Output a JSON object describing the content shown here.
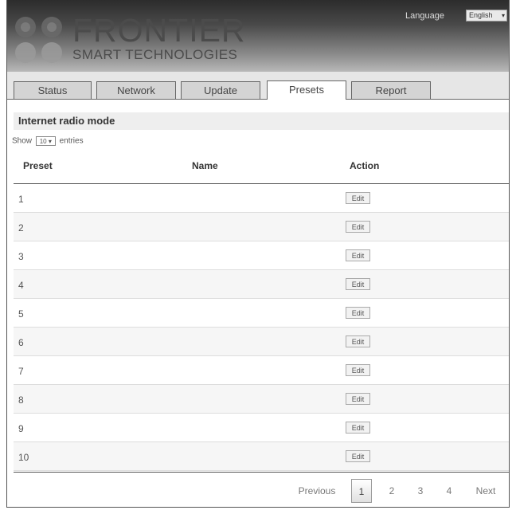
{
  "header": {
    "logo_main": "FRONTIER",
    "logo_sub": "SMART TECHNOLOGIES",
    "language_label": "Language",
    "language_value": "English"
  },
  "tabs": [
    {
      "label": "Status"
    },
    {
      "label": "Network"
    },
    {
      "label": "Update"
    },
    {
      "label": "Presets",
      "active": true
    },
    {
      "label": "Report"
    }
  ],
  "section": {
    "title": "Internet radio mode",
    "show_prefix": "Show",
    "show_value": "10",
    "show_suffix": "entries"
  },
  "table": {
    "columns": [
      "Preset",
      "Name",
      "Action"
    ],
    "rows": [
      {
        "preset": "1",
        "name": "",
        "action": "Edit"
      },
      {
        "preset": "2",
        "name": "",
        "action": "Edit"
      },
      {
        "preset": "3",
        "name": "",
        "action": "Edit"
      },
      {
        "preset": "4",
        "name": "",
        "action": "Edit"
      },
      {
        "preset": "5",
        "name": "",
        "action": "Edit"
      },
      {
        "preset": "6",
        "name": "",
        "action": "Edit"
      },
      {
        "preset": "7",
        "name": "",
        "action": "Edit"
      },
      {
        "preset": "8",
        "name": "",
        "action": "Edit"
      },
      {
        "preset": "9",
        "name": "",
        "action": "Edit"
      },
      {
        "preset": "10",
        "name": "",
        "action": "Edit"
      }
    ]
  },
  "pagination": {
    "previous": "Previous",
    "pages": [
      "1",
      "2",
      "3",
      "4"
    ],
    "current": "1",
    "next": "Next"
  }
}
